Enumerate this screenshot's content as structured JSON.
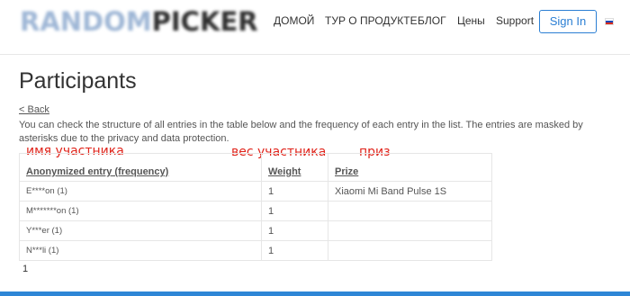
{
  "header": {
    "logo": {
      "part1": "RANDOM",
      "part2": "PICKER"
    },
    "nav": [
      "ДОМОЙ",
      "ТУР О ПРОДУКТЕ",
      "БЛОГ",
      "Цены",
      "Support"
    ],
    "signin": "Sign In",
    "language_flag": "russian-flag-icon"
  },
  "page": {
    "title": "Participants",
    "back": "< Back",
    "description": "You can check the structure of all entries in the table below and the frequency of each entry in the list. The entries are masked by asterisks due to the privacy and data protection."
  },
  "annotations": {
    "name": "имя участника",
    "weight": "вес участника",
    "prize": "приз"
  },
  "table": {
    "headers": [
      "Anonymized entry (frequency)",
      "Weight",
      "Prize"
    ],
    "rows": [
      {
        "entry": "E****on (1)",
        "weight": "1",
        "prize": "Xiaomi Mi Band Pulse 1S"
      },
      {
        "entry": "M*******on (1)",
        "weight": "1",
        "prize": ""
      },
      {
        "entry": "Y***er (1)",
        "weight": "1",
        "prize": ""
      },
      {
        "entry": "N***li (1)",
        "weight": "1",
        "prize": ""
      }
    ]
  },
  "pagination": {
    "current": "1"
  },
  "colors": {
    "accent": "#2b7fd4",
    "annotation": "#e0231a",
    "bottom_bar": "#2e86d6"
  }
}
